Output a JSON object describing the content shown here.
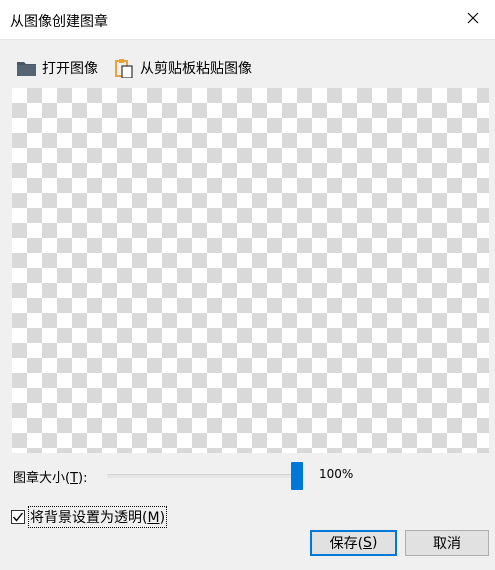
{
  "window": {
    "title": "从图像创建图章",
    "close_icon": "close-icon"
  },
  "toolbar": {
    "open_label": "打开图像",
    "open_icon": "folder-icon",
    "paste_label": "从剪贴板粘贴图像",
    "paste_icon": "clipboard-paste-icon"
  },
  "canvas": {
    "background": "transparent-checkerboard"
  },
  "size": {
    "label_prefix": "图章大小(",
    "label_key": "T",
    "label_suffix": "):",
    "value_fraction": 1.0,
    "value_text": "100%"
  },
  "transparent": {
    "checked": true,
    "label_prefix": "将背景设置为透明(",
    "label_key": "M",
    "label_suffix": ")"
  },
  "buttons": {
    "save_prefix": "保存(",
    "save_key": "S",
    "save_suffix": ")",
    "cancel_label": "取消"
  },
  "colors": {
    "accent": "#0078d7",
    "folder_icon": "#4a5866",
    "clipboard_icon": "#e8a33d"
  }
}
